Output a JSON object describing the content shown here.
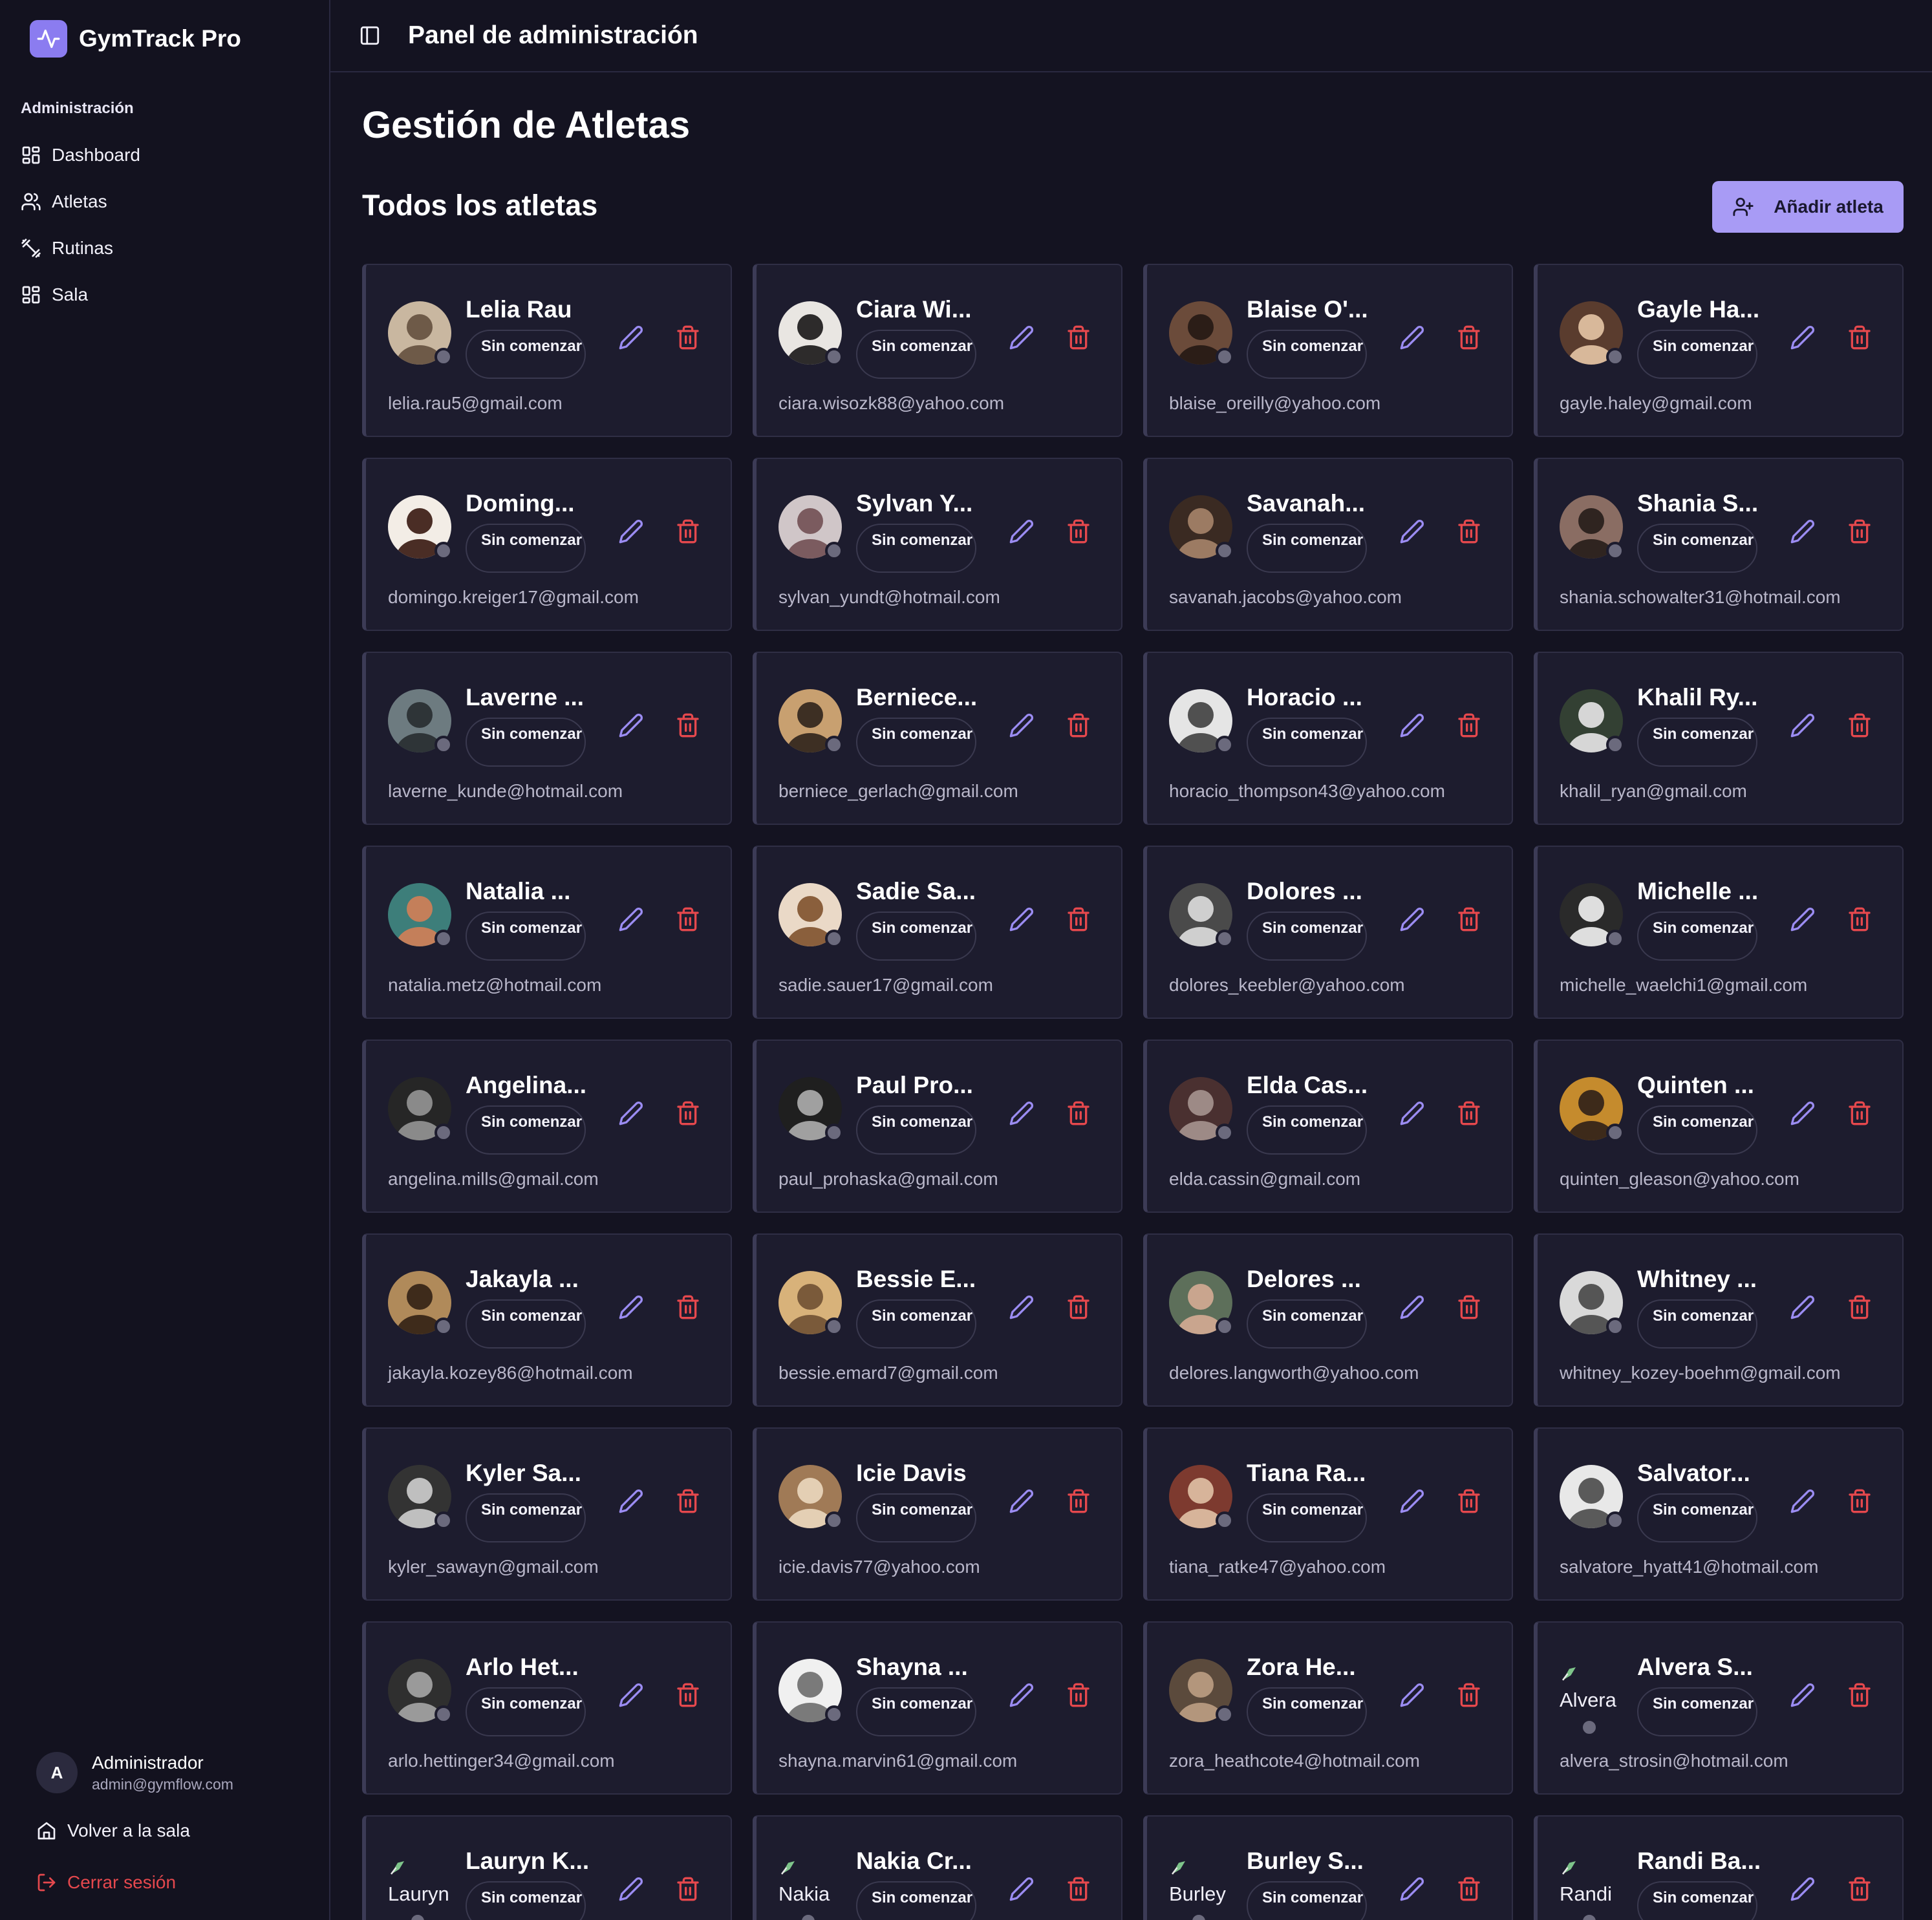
{
  "app": {
    "name": "GymTrack Pro"
  },
  "sidebar": {
    "section": "Administración",
    "items": [
      {
        "label": "Dashboard",
        "icon": "dashboard-icon"
      },
      {
        "label": "Atletas",
        "icon": "users-icon"
      },
      {
        "label": "Rutinas",
        "icon": "dumbbell-icon"
      },
      {
        "label": "Sala",
        "icon": "grid-icon"
      }
    ],
    "user": {
      "initial": "A",
      "name": "Administrador",
      "email": "admin@gymflow.com"
    },
    "back_label": "Volver a la sala",
    "logout_label": "Cerrar sesión"
  },
  "header": {
    "title": "Panel de administración"
  },
  "main": {
    "title": "Gestión de Atletas",
    "section_title": "Todos los atletas",
    "add_button": "Añadir atleta"
  },
  "colors": {
    "accent": "#a89bf5",
    "danger": "#e5484d",
    "background": "#141321",
    "card": "#1d1c2e"
  },
  "athletes": [
    {
      "name": "Lelia Rau",
      "status": "Sin comenzar",
      "email": "lelia.rau5@gmail.com"
    },
    {
      "name": "Ciara Wi...",
      "status": "Sin comenzar",
      "email": "ciara.wisozk88@yahoo.com"
    },
    {
      "name": "Blaise O'...",
      "status": "Sin comenzar",
      "email": "blaise_oreilly@yahoo.com"
    },
    {
      "name": "Gayle Ha...",
      "status": "Sin comenzar",
      "email": "gayle.haley@gmail.com"
    },
    {
      "name": "Doming...",
      "status": "Sin comenzar",
      "email": "domingo.kreiger17@gmail.com"
    },
    {
      "name": "Sylvan Y...",
      "status": "Sin comenzar",
      "email": "sylvan_yundt@hotmail.com"
    },
    {
      "name": "Savanah...",
      "status": "Sin comenzar",
      "email": "savanah.jacobs@yahoo.com"
    },
    {
      "name": "Shania S...",
      "status": "Sin comenzar",
      "email": "shania.schowalter31@hotmail.com"
    },
    {
      "name": "Laverne ...",
      "status": "Sin comenzar",
      "email": "laverne_kunde@hotmail.com"
    },
    {
      "name": "Berniece...",
      "status": "Sin comenzar",
      "email": "berniece_gerlach@gmail.com"
    },
    {
      "name": "Horacio ...",
      "status": "Sin comenzar",
      "email": "horacio_thompson43@yahoo.com"
    },
    {
      "name": "Khalil Ry...",
      "status": "Sin comenzar",
      "email": "khalil_ryan@gmail.com"
    },
    {
      "name": "Natalia ...",
      "status": "Sin comenzar",
      "email": "natalia.metz@hotmail.com"
    },
    {
      "name": "Sadie Sa...",
      "status": "Sin comenzar",
      "email": "sadie.sauer17@gmail.com"
    },
    {
      "name": "Dolores ...",
      "status": "Sin comenzar",
      "email": "dolores_keebler@yahoo.com"
    },
    {
      "name": "Michelle ...",
      "status": "Sin comenzar",
      "email": "michelle_waelchi1@gmail.com"
    },
    {
      "name": "Angelina...",
      "status": "Sin comenzar",
      "email": "angelina.mills@gmail.com"
    },
    {
      "name": "Paul Pro...",
      "status": "Sin comenzar",
      "email": "paul_prohaska@gmail.com"
    },
    {
      "name": "Elda Cas...",
      "status": "Sin comenzar",
      "email": "elda.cassin@gmail.com"
    },
    {
      "name": "Quinten ...",
      "status": "Sin comenzar",
      "email": "quinten_gleason@yahoo.com"
    },
    {
      "name": "Jakayla ...",
      "status": "Sin comenzar",
      "email": "jakayla.kozey86@hotmail.com"
    },
    {
      "name": "Bessie E...",
      "status": "Sin comenzar",
      "email": "bessie.emard7@gmail.com"
    },
    {
      "name": "Delores ...",
      "status": "Sin comenzar",
      "email": "delores.langworth@yahoo.com"
    },
    {
      "name": "Whitney ...",
      "status": "Sin comenzar",
      "email": "whitney_kozey-boehm@gmail.com"
    },
    {
      "name": "Kyler Sa...",
      "status": "Sin comenzar",
      "email": "kyler_sawayn@gmail.com"
    },
    {
      "name": "Icie Davis",
      "status": "Sin comenzar",
      "email": "icie.davis77@yahoo.com"
    },
    {
      "name": "Tiana Ra...",
      "status": "Sin comenzar",
      "email": "tiana_ratke47@yahoo.com"
    },
    {
      "name": "Salvator...",
      "status": "Sin comenzar",
      "email": "salvatore_hyatt41@hotmail.com"
    },
    {
      "name": "Arlo Het...",
      "status": "Sin comenzar",
      "email": "arlo.hettinger34@gmail.com"
    },
    {
      "name": "Shayna ...",
      "status": "Sin comenzar",
      "email": "shayna.marvin61@gmail.com"
    },
    {
      "name": "Zora He...",
      "status": "Sin comenzar",
      "email": "zora_heathcote4@hotmail.com"
    },
    {
      "name": "Alvera S...",
      "status": "Sin comenzar",
      "email": "alvera_strosin@hotmail.com",
      "image_alt": "Alvera"
    },
    {
      "name": "Lauryn K...",
      "status": "Sin comenzar",
      "email": "",
      "image_alt": "Lauryn"
    },
    {
      "name": "Nakia Cr...",
      "status": "Sin comenzar",
      "email": "",
      "image_alt": "Nakia"
    },
    {
      "name": "Burley S...",
      "status": "Sin comenzar",
      "email": "",
      "image_alt": "Burley"
    },
    {
      "name": "Randi Ba...",
      "status": "Sin comenzar",
      "email": "",
      "image_alt": "Randi"
    }
  ]
}
